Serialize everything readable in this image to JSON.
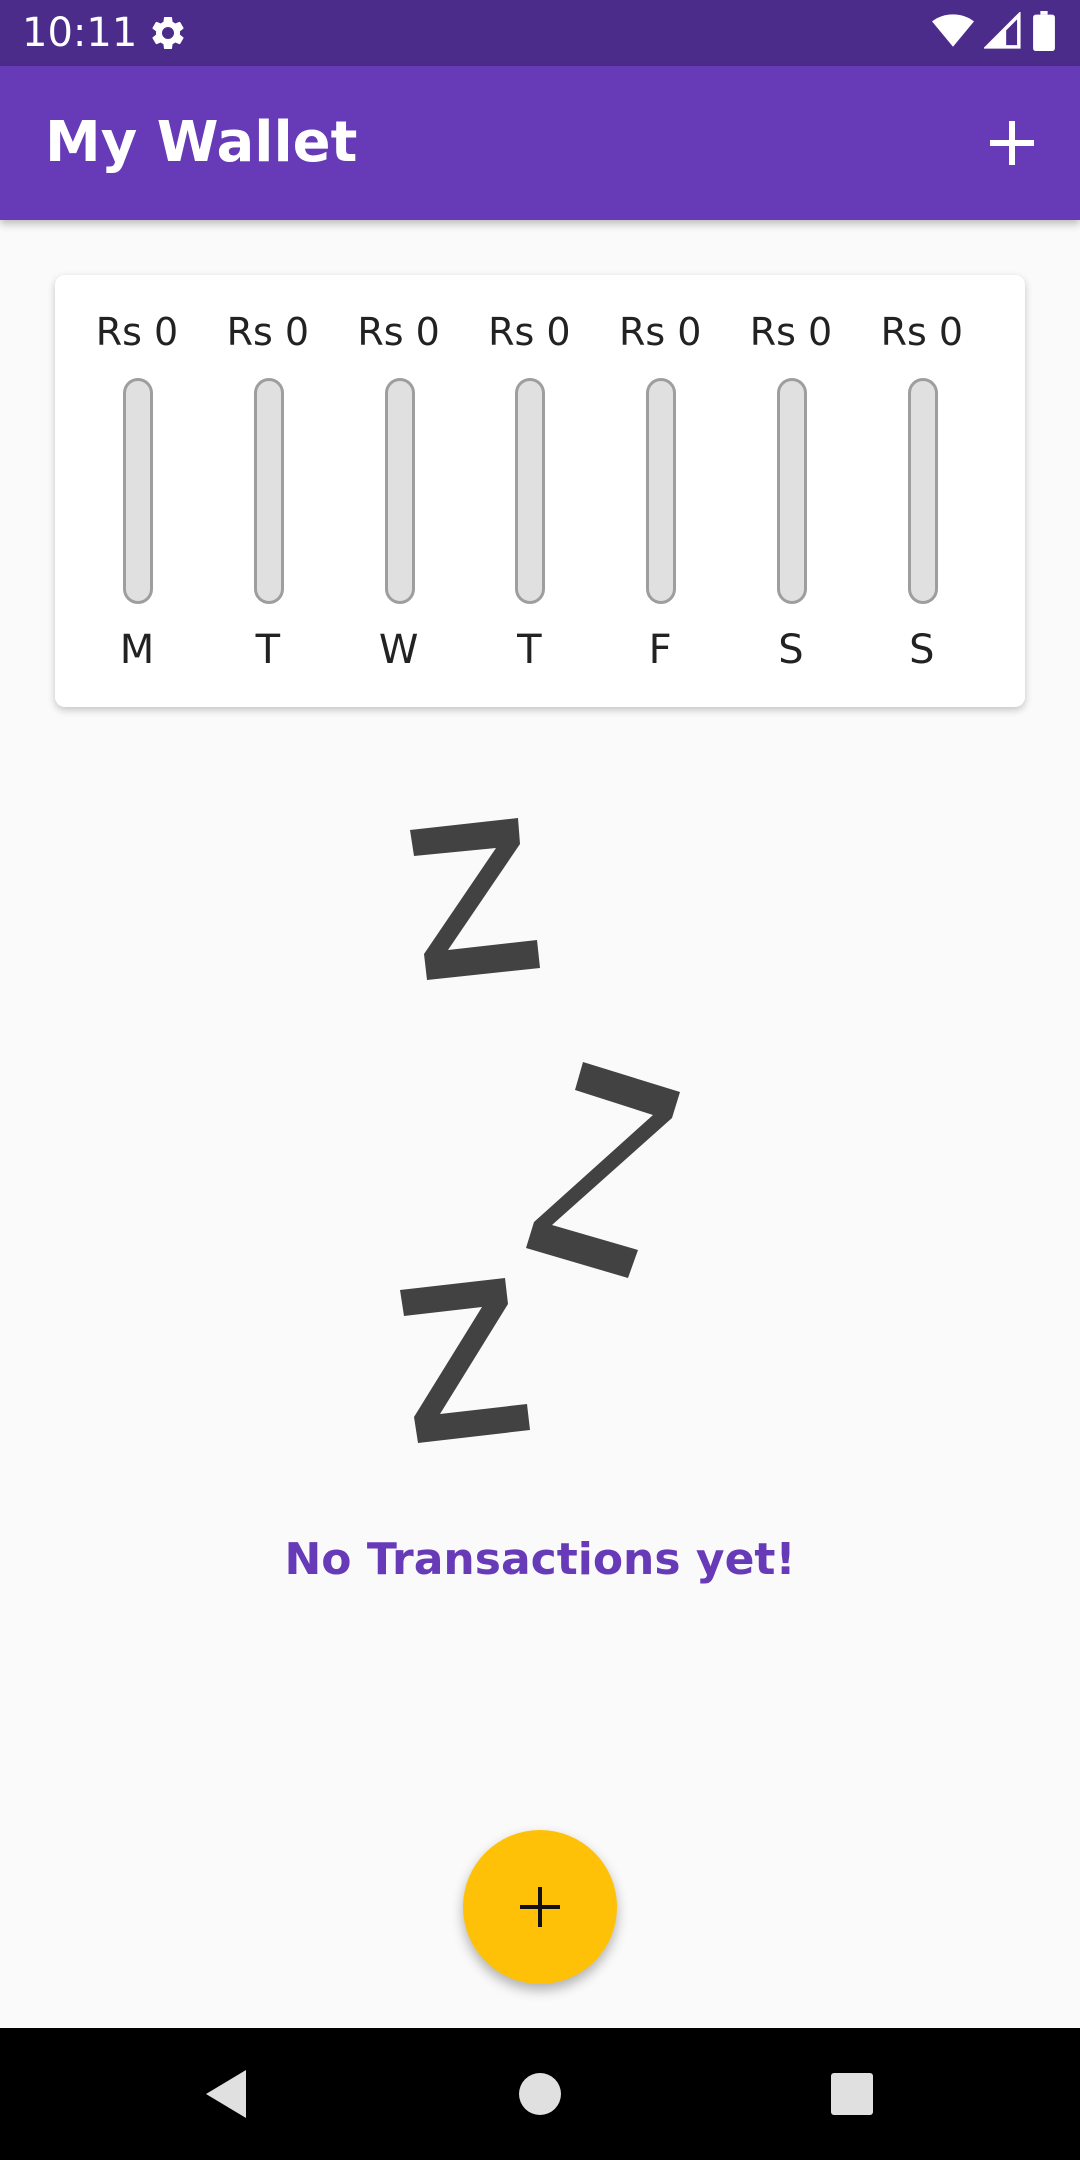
{
  "status_bar": {
    "time": "10:11",
    "icons": [
      "gear-icon",
      "wifi-icon",
      "signal-icon",
      "battery-icon"
    ]
  },
  "app_bar": {
    "title": "My Wallet",
    "add_icon": "plus-icon"
  },
  "chart": {
    "days": [
      {
        "amount": "Rs 0",
        "label": "M",
        "fraction": 0
      },
      {
        "amount": "Rs 0",
        "label": "T",
        "fraction": 0
      },
      {
        "amount": "Rs 0",
        "label": "W",
        "fraction": 0
      },
      {
        "amount": "Rs 0",
        "label": "T",
        "fraction": 0
      },
      {
        "amount": "Rs 0",
        "label": "F",
        "fraction": 0
      },
      {
        "amount": "Rs 0",
        "label": "S",
        "fraction": 0
      },
      {
        "amount": "Rs 0",
        "label": "S",
        "fraction": 0
      }
    ]
  },
  "empty_state": {
    "image": "zzz-sleeping-illustration",
    "message": "No Transactions yet!"
  },
  "fab": {
    "icon": "plus-icon",
    "color": "#ffc107"
  },
  "nav_bar": {
    "icons": [
      "back-icon",
      "home-icon",
      "recents-icon"
    ]
  },
  "colors": {
    "primary": "#673ab7",
    "primary_dark": "#4c2c8a",
    "accent": "#ffc107"
  }
}
